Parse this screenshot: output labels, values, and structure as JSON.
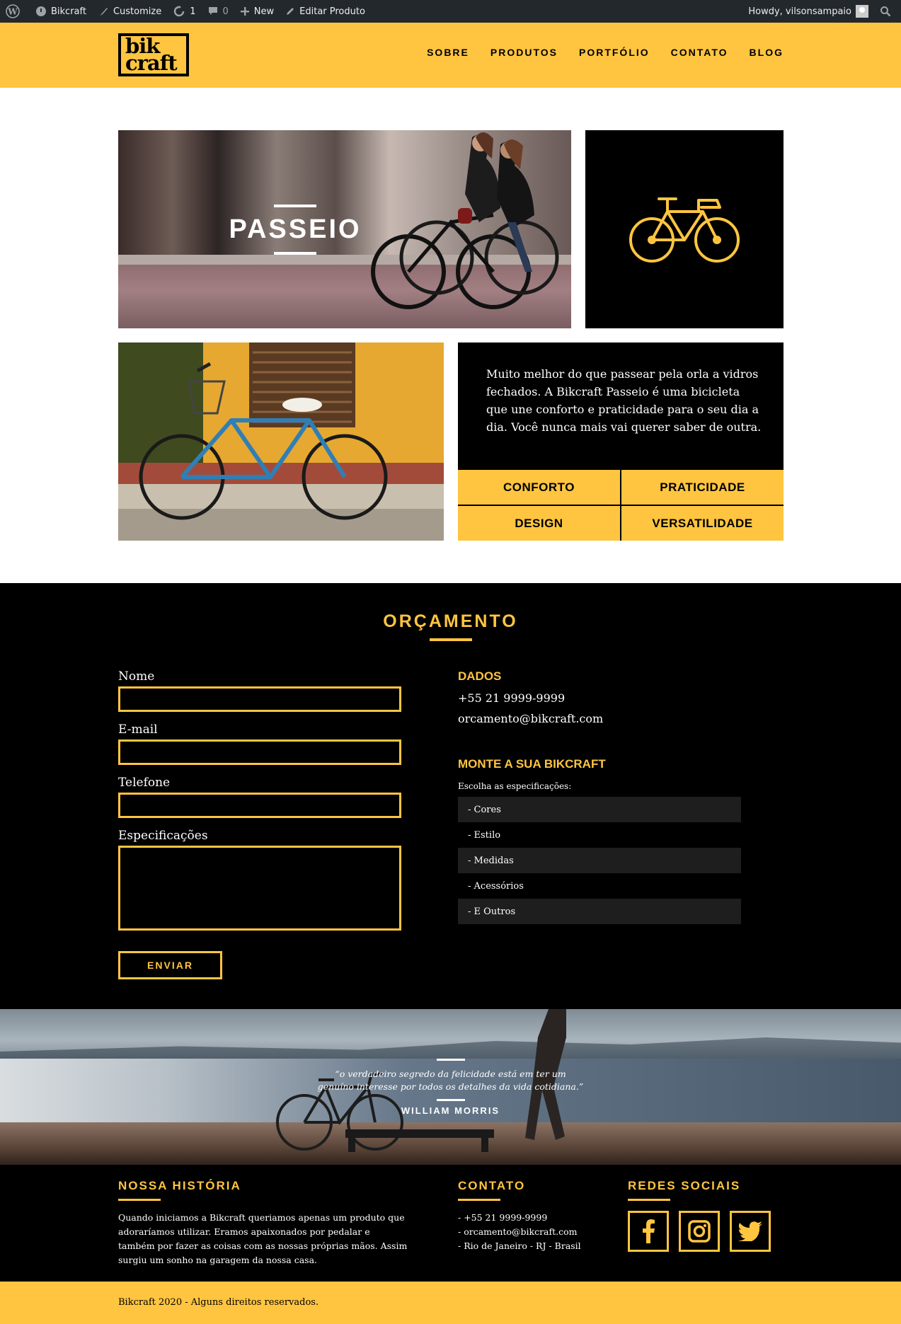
{
  "adminbar": {
    "site": "Bikcraft",
    "customize": "Customize",
    "updates": "1",
    "comments": "0",
    "new": "New",
    "edit": "Editar Produto",
    "howdy": "Howdy, vilsonsampaio"
  },
  "header": {
    "logo_line1": "bik",
    "logo_line2": "craft",
    "nav": [
      "SOBRE",
      "PRODUTOS",
      "PORTFÓLIO",
      "CONTATO",
      "BLOG"
    ]
  },
  "product": {
    "title": "PASSEIO",
    "description": "Muito melhor do que passear pela orla a vidros fechados. A Bikcraft Passeio é uma bicicleta que une conforto e praticidade para o seu dia a dia. Você nunca mais vai querer saber de outra.",
    "features": [
      "CONFORTO",
      "PRATICIDADE",
      "DESIGN",
      "VERSATILIDADE"
    ]
  },
  "orcamento": {
    "title": "ORÇAMENTO",
    "fields": {
      "nome": "Nome",
      "email": "E-mail",
      "telefone": "Telefone",
      "especificacoes": "Especificações"
    },
    "submit": "ENVIAR",
    "dados_title": "DADOS",
    "phone": "+55 21 9999-9999",
    "email": "orcamento@bikcraft.com",
    "monte_title": "MONTE A SUA BIKCRAFT",
    "monte_sub": "Escolha as especificações:",
    "specs": [
      "- Cores",
      "- Estilo",
      "- Medidas",
      "- Acessórios",
      "- E Outros"
    ]
  },
  "quote": {
    "text": "“o verdadeiro segredo da felicidade está em ter um genuíno interesse por todos os detalhes da vida cotidiana.”",
    "author": "WILLIAM MORRIS"
  },
  "footer": {
    "historia_title": "NOSSA HISTÓRIA",
    "historia_text": "Quando iniciamos a Bikcraft queriamos apenas um produto que adoraríamos utilizar. Eramos apaixonados por pedalar e também por fazer as coisas com as nossas próprias mãos. Assim surgiu um sonho na garagem da nossa casa.",
    "contato_title": "CONTATO",
    "contato_lines": [
      "- +55 21 9999-9999",
      "- orcamento@bikcraft.com",
      "- Rio de Janeiro - RJ - Brasil"
    ],
    "redes_title": "REDES SOCIAIS",
    "social_icons": [
      "facebook-icon",
      "instagram-icon",
      "twitter-icon"
    ],
    "copyright": "Bikcraft 2020 - Alguns direitos reservados."
  },
  "colors": {
    "accent": "#ffc540",
    "dark": "#000000",
    "adminbar": "#23282d"
  }
}
